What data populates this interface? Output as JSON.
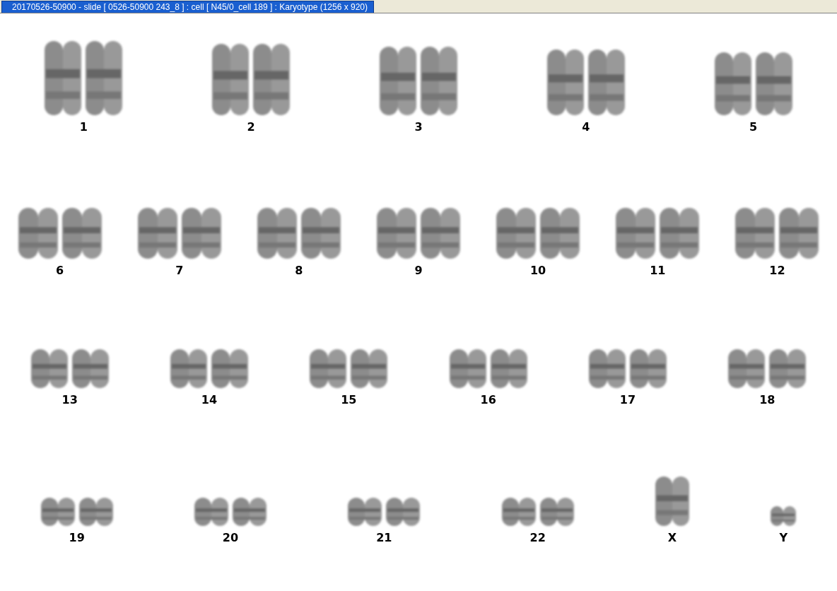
{
  "title_tab": {
    "text": "20170526-50900 - slide [ 0526-50900 243_8 ] : cell [ N45/0_cell 189 ] : Karyotype  (1256 x 920)"
  },
  "rows": [
    {
      "pairs": [
        {
          "label": "1"
        },
        {
          "label": "2"
        },
        {
          "label": "3"
        },
        {
          "label": "4"
        },
        {
          "label": "5"
        }
      ]
    },
    {
      "pairs": [
        {
          "label": "6"
        },
        {
          "label": "7"
        },
        {
          "label": "8"
        },
        {
          "label": "9"
        },
        {
          "label": "10"
        },
        {
          "label": "11"
        },
        {
          "label": "12"
        }
      ]
    },
    {
      "pairs": [
        {
          "label": "13"
        },
        {
          "label": "14"
        },
        {
          "label": "15"
        },
        {
          "label": "16"
        },
        {
          "label": "17"
        },
        {
          "label": "18"
        }
      ]
    },
    {
      "pairs": [
        {
          "label": "19"
        },
        {
          "label": "20"
        },
        {
          "label": "21"
        },
        {
          "label": "22"
        },
        {
          "label": "X"
        },
        {
          "label": "Y"
        }
      ]
    }
  ]
}
